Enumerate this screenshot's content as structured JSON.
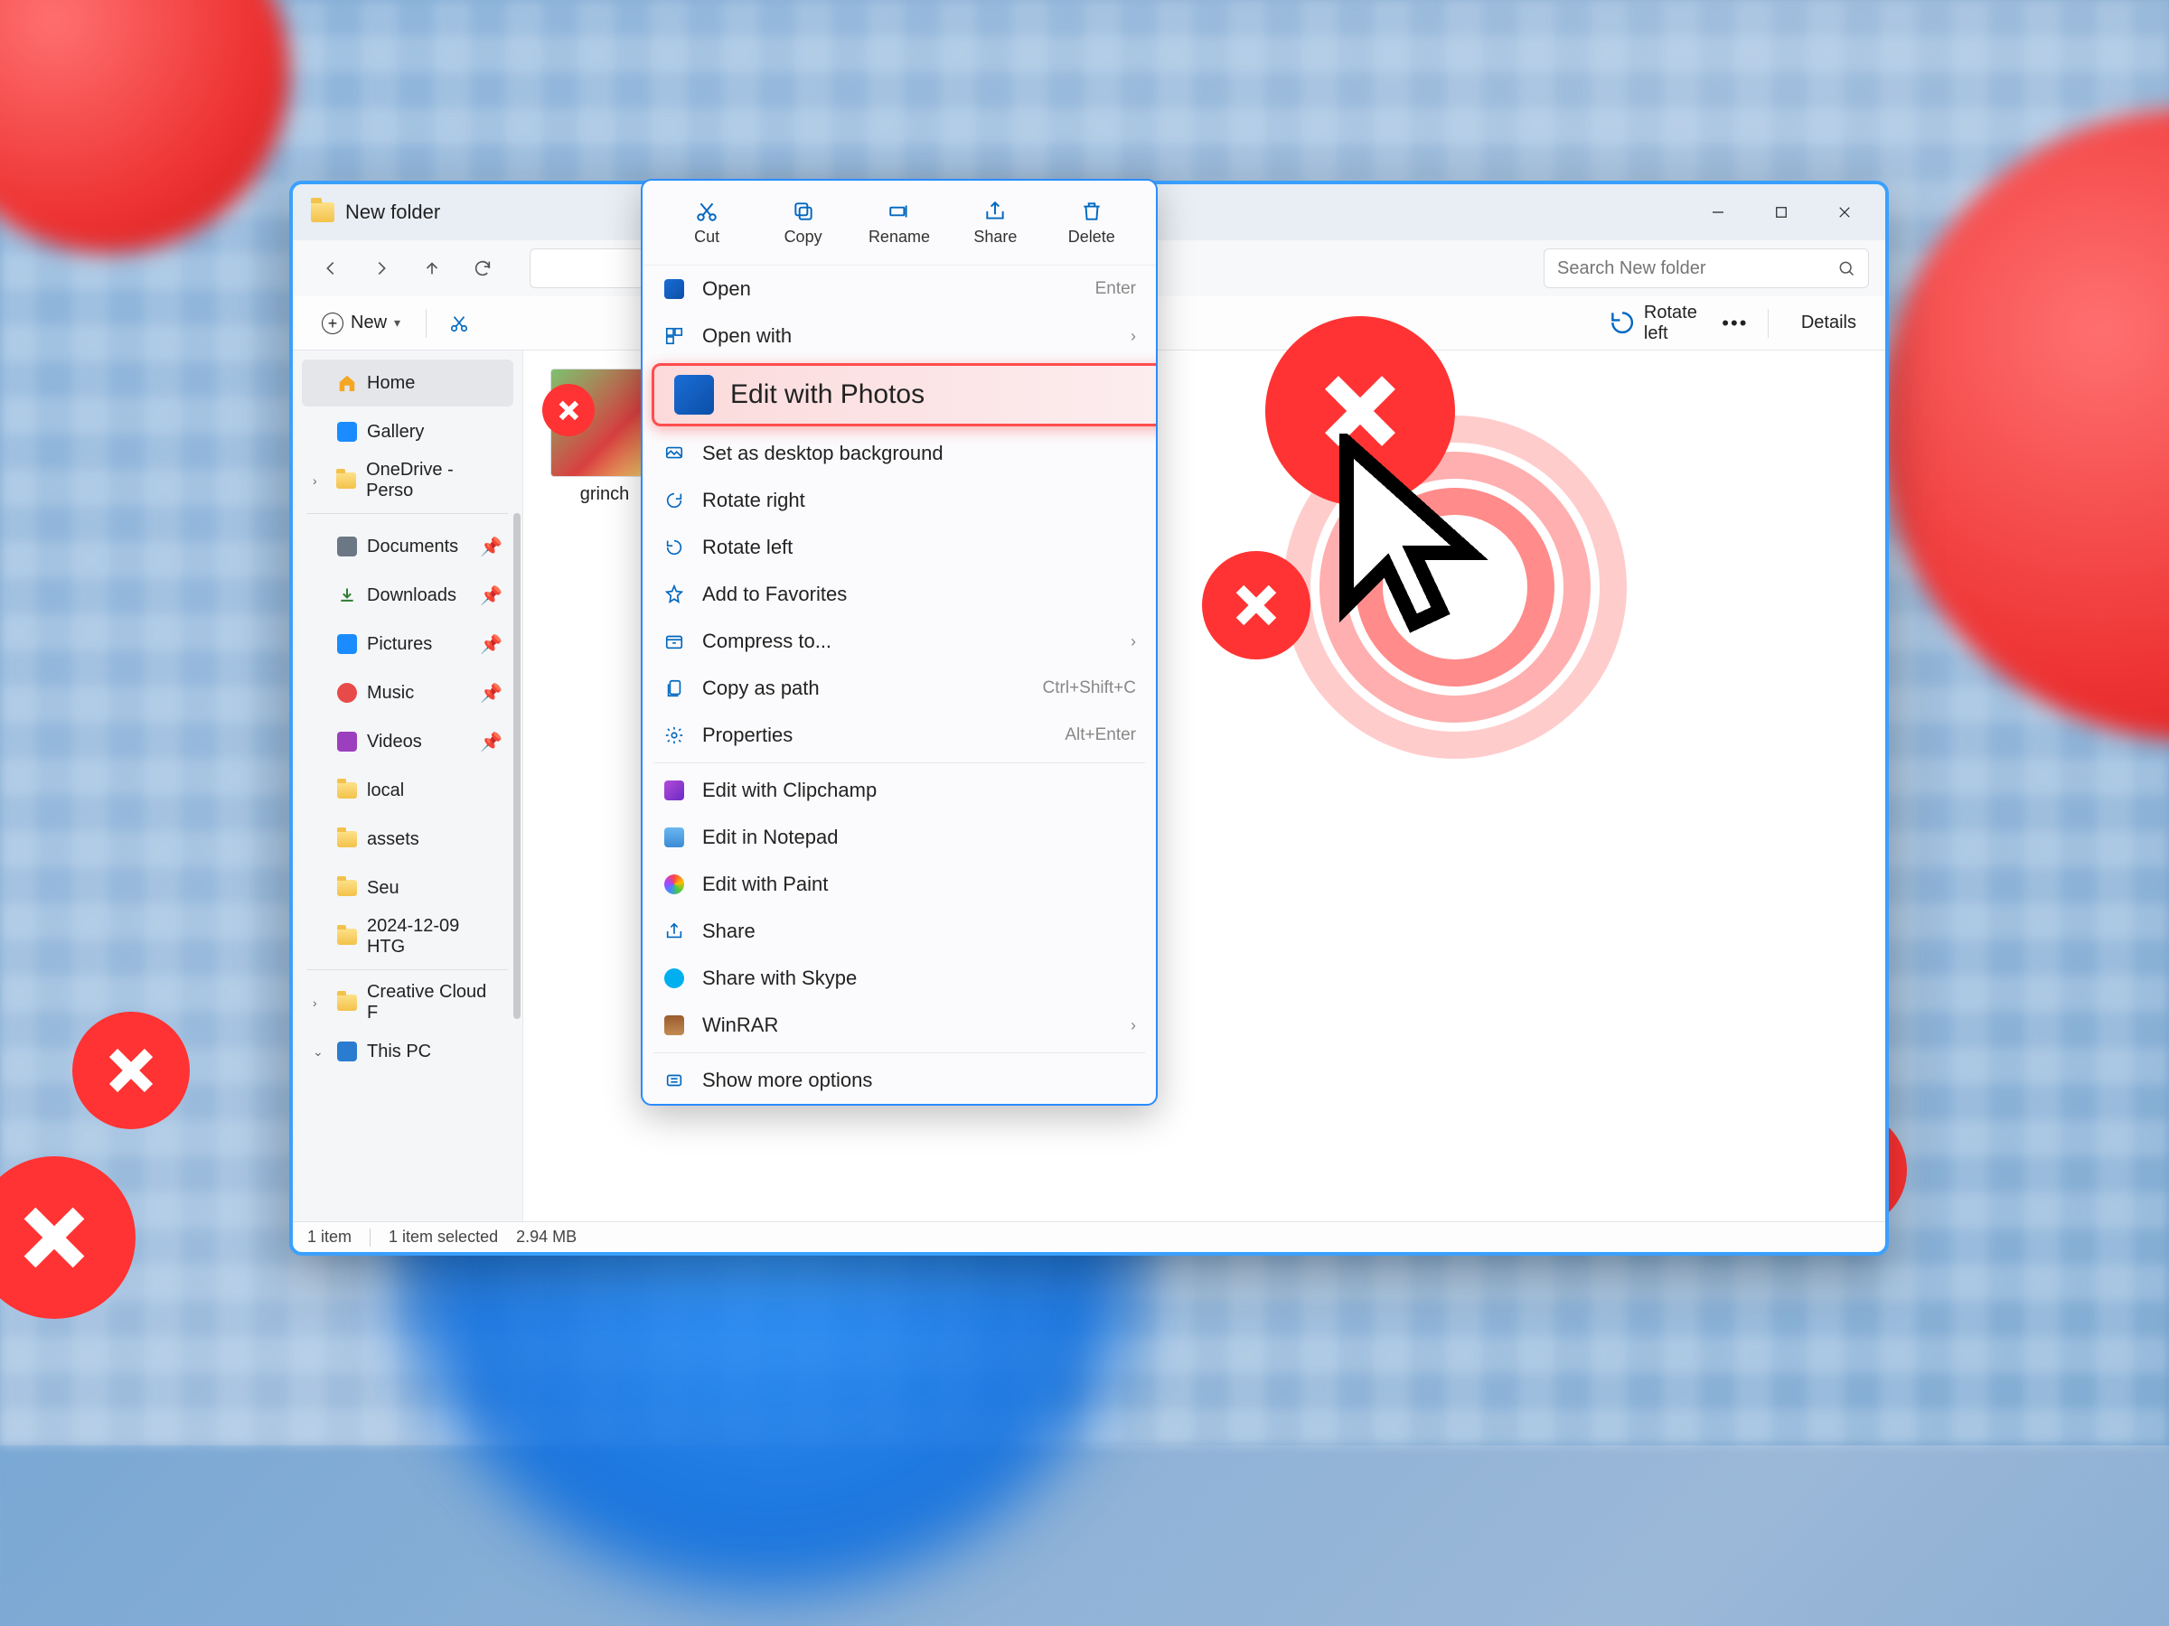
{
  "window": {
    "title": "New folder"
  },
  "search": {
    "placeholder": "Search New folder"
  },
  "toolbar": {
    "new": "New",
    "rotate_left": "Rotate left",
    "details": "Details"
  },
  "sidebar": {
    "home": "Home",
    "gallery": "Gallery",
    "onedrive": "OneDrive - Perso",
    "documents": "Documents",
    "downloads": "Downloads",
    "pictures": "Pictures",
    "music": "Music",
    "videos": "Videos",
    "local": "local",
    "assets": "assets",
    "seu": "Seu",
    "dated": "2024-12-09 HTG",
    "creative": "Creative Cloud F",
    "thispc": "This PC"
  },
  "file": {
    "name": "grinch"
  },
  "status": {
    "count": "1 item",
    "selected": "1 item selected",
    "size": "2.94 MB"
  },
  "context": {
    "top": {
      "cut": "Cut",
      "copy": "Copy",
      "rename": "Rename",
      "share": "Share",
      "delete": "Delete"
    },
    "open": "Open",
    "open_short": "Enter",
    "open_with": "Open with",
    "edit_photos": "Edit with Photos",
    "set_bg": "Set as desktop background",
    "rotate_right": "Rotate right",
    "rotate_left": "Rotate left",
    "favorites": "Add to Favorites",
    "compress": "Compress to...",
    "copy_path": "Copy as path",
    "copy_path_short": "Ctrl+Shift+C",
    "properties": "Properties",
    "properties_short": "Alt+Enter",
    "clipchamp": "Edit with Clipchamp",
    "notepad": "Edit in Notepad",
    "paint": "Edit with Paint",
    "share2": "Share",
    "skype": "Share with Skype",
    "winrar": "WinRAR",
    "more": "Show more options"
  }
}
